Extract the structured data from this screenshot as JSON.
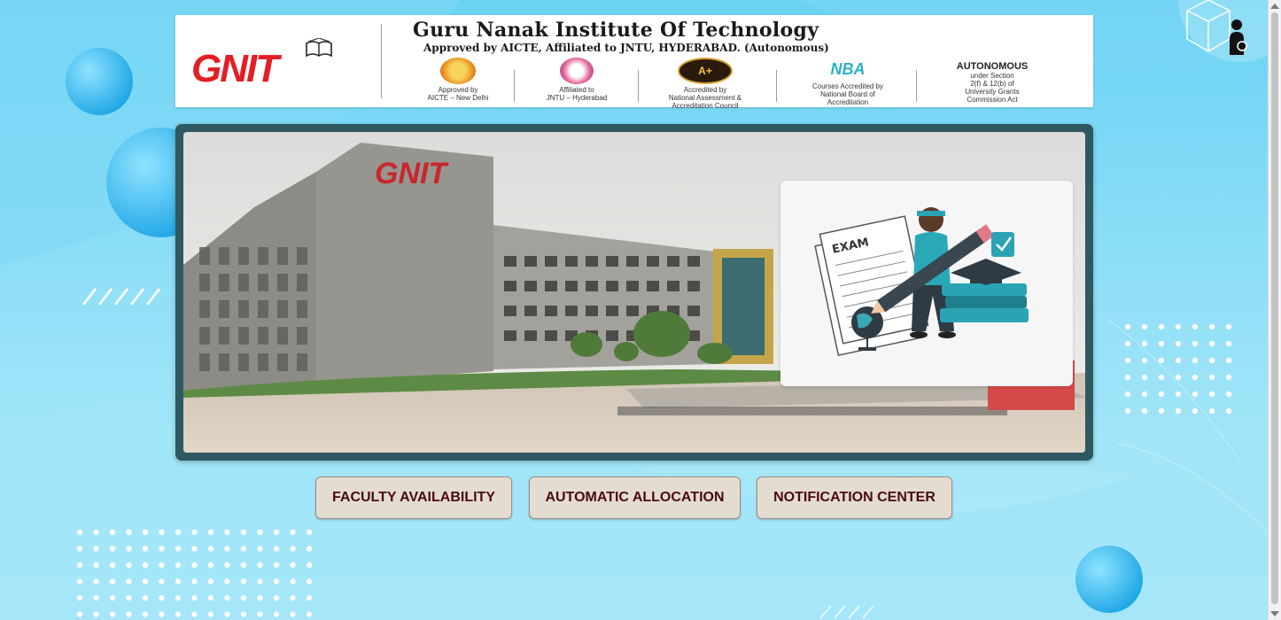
{
  "banner": {
    "logo_text": "GNIT",
    "institute_name": "Guru Nanak Institute Of Technology",
    "institute_sub": "Approved by AICTE, Affiliated to JNTU, HYDERABAD. (Autonomous)",
    "accreditations": [
      {
        "caption": "Approved by\nAICTE – New Delhi"
      },
      {
        "caption": "Affiliated to\nJNTU – Hyderabad"
      },
      {
        "caption": "Accredited by\nNational Assessment &\nAccreditation Council",
        "badge": "A+"
      },
      {
        "caption": "Courses Accredited by\nNational Board of\nAccreditation",
        "badge": "NBA"
      },
      {
        "title": "AUTONOMOUS",
        "caption": "under Section\n2(f) & 12(b) of\nUniversity Grants\nCommission Act"
      }
    ]
  },
  "hero": {
    "building_sign": "GNIT",
    "illustration_label": "EXAM"
  },
  "actions": {
    "faculty_availability": "FACULTY AVAILABILITY",
    "automatic_allocation": "AUTOMATIC ALLOCATION",
    "notification_center": "NOTIFICATION CENTER"
  },
  "icons": {
    "profile": "user-profile-icon"
  },
  "colors": {
    "button_bg": "#e4dcd0",
    "button_text": "#4a0c10",
    "hero_frame": "#2f5960",
    "logo_red": "#e31e24"
  }
}
